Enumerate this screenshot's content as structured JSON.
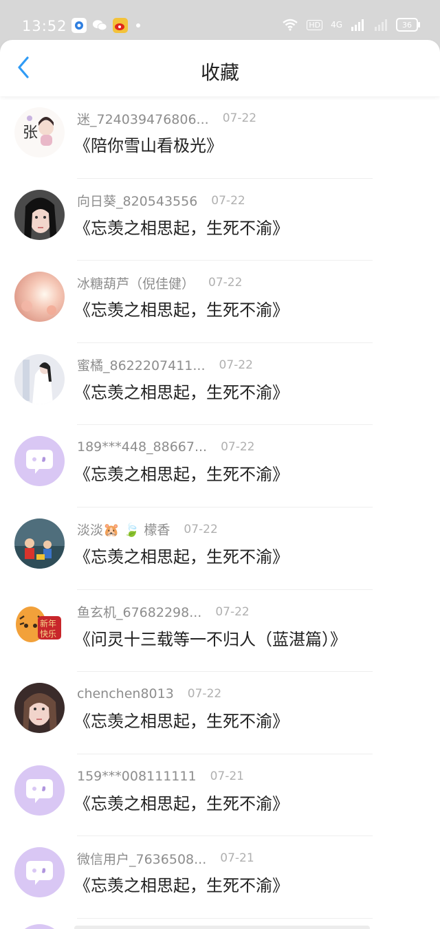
{
  "status_bar": {
    "time": "13:52",
    "battery": "36",
    "hd_label": "HD",
    "network_label": "4G"
  },
  "header": {
    "title": "收藏"
  },
  "favorites": [
    {
      "user": "迷_724039476806...",
      "date": "07-22",
      "song": "《陪你雪山看极光》"
    },
    {
      "user": "向日葵_820543556",
      "date": "07-22",
      "song": "《忘羡之相思起，生死不渝》"
    },
    {
      "user": "冰糖葫芦（倪佳健）",
      "date": "07-22",
      "song": "《忘羡之相思起，生死不渝》"
    },
    {
      "user": "蜜橘_8622207411...",
      "date": "07-22",
      "song": "《忘羡之相思起，生死不渝》"
    },
    {
      "user": "189***448_88667...",
      "date": "07-22",
      "song": "《忘羡之相思起，生死不渝》"
    },
    {
      "user": "淡淡🐹 🍃 檬香",
      "date": "07-22",
      "song": "《忘羡之相思起，生死不渝》"
    },
    {
      "user": "鱼玄机_67682298...",
      "date": "07-22",
      "song": "《问灵十三载等一不归人（蓝湛篇）》"
    },
    {
      "user": "chenchen8013",
      "date": "07-22",
      "song": "《忘羡之相思起，生死不渝》"
    },
    {
      "user": "159***008111111",
      "date": "07-21",
      "song": "《忘羡之相思起，生死不渝》"
    },
    {
      "user": "微信用户_7636508...",
      "date": "07-21",
      "song": "《忘羡之相思起，生死不渝》"
    }
  ],
  "colors": {
    "accent": "#2f9bf5",
    "default_avatar_bg": "#d9c7f4",
    "default_avatar_bubble": "#ffffff"
  }
}
